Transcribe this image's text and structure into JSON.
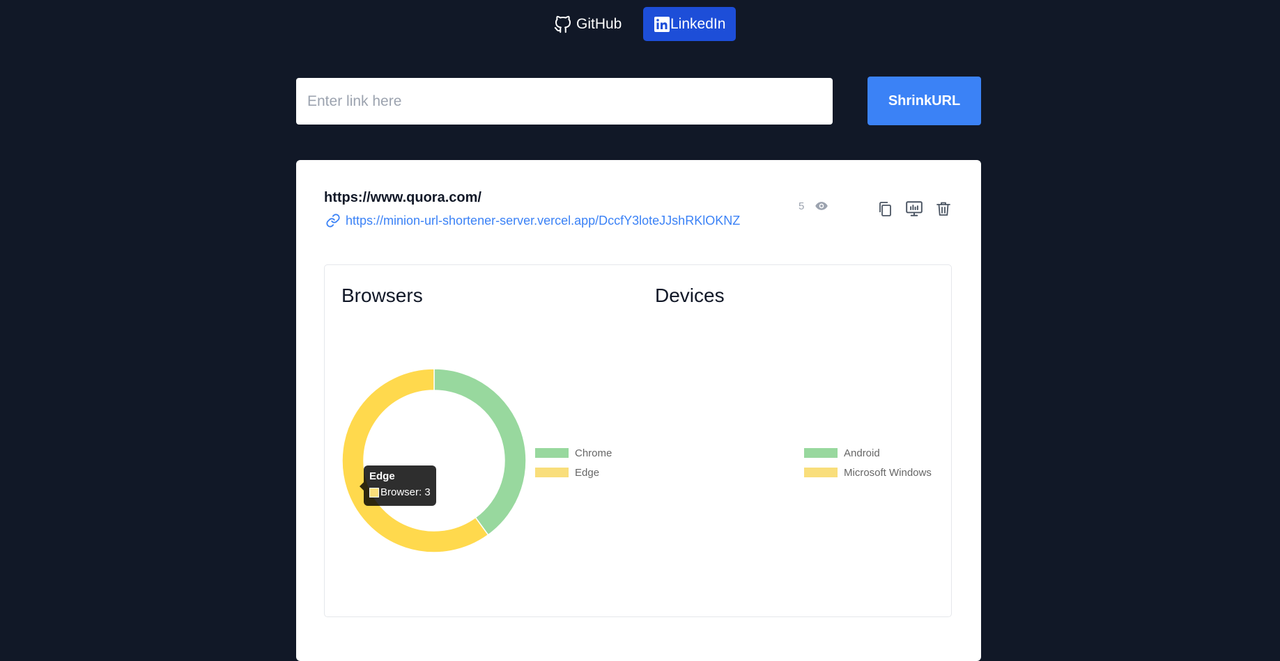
{
  "nav": {
    "github_label": "GitHub",
    "linkedin_label": "LinkedIn"
  },
  "shortener": {
    "input_value": "",
    "input_placeholder": "Enter link here",
    "button_label": "ShrinkURL"
  },
  "link_card": {
    "original_url": "https://www.quora.com/",
    "short_url": "https://minion-url-shortener-server.vercel.app/DccfY3loteJJshRKlOKNZ",
    "view_count": "5",
    "icons": [
      "link-icon",
      "eye-icon",
      "copy-icon",
      "qr-code-icon",
      "trash-icon"
    ]
  },
  "stats": {
    "browsers_title": "Browsers",
    "devices_title": "Devices",
    "tooltip": {
      "title": "Edge",
      "body": "Browser: 3"
    }
  },
  "colors": {
    "background": "#111827",
    "accent": "#3b82f6",
    "linkedin_active": "#1d4ed8",
    "series_green": "#98d89e",
    "series_yellow": "#ffd94d",
    "legend_yellow": "#f9de7b"
  },
  "chart_data": [
    {
      "type": "pie",
      "title": "Browsers",
      "categories": [
        "Chrome",
        "Edge"
      ],
      "values": [
        2,
        3
      ],
      "legend_position": "right"
    },
    {
      "type": "pie",
      "title": "Devices",
      "categories": [
        "Android",
        "Microsoft Windows"
      ],
      "values": [],
      "legend_position": "right"
    }
  ]
}
